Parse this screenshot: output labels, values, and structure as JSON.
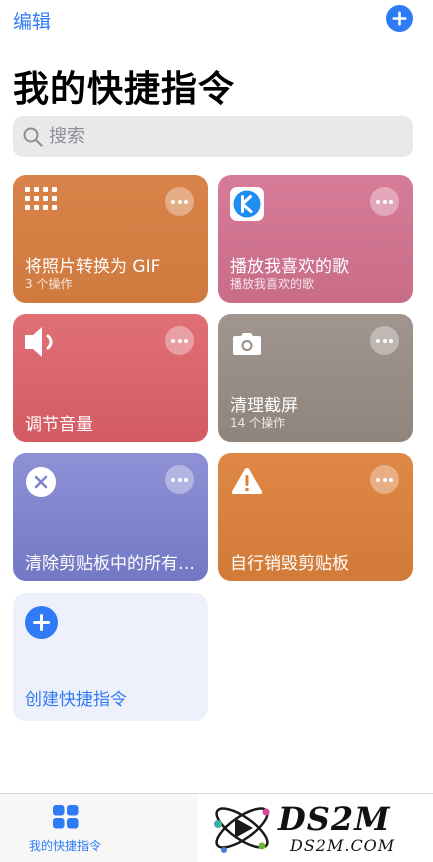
{
  "nav": {
    "edit_label": "编辑",
    "add_icon": "plus-circle-icon"
  },
  "page_title": "我的快捷指令",
  "search": {
    "placeholder": "搜索",
    "value": ""
  },
  "cards": [
    {
      "title": "将照片转换为 GIF",
      "subtitle": "3 个操作",
      "icon": "grid-icon",
      "color": "#d47e44"
    },
    {
      "title": "播放我喜欢的歌",
      "subtitle": "播放我喜欢的歌",
      "icon": "kugou-app-icon",
      "color": "#cf7390"
    },
    {
      "title": "调节音量",
      "subtitle": "",
      "icon": "speaker-icon",
      "color": "#da6369"
    },
    {
      "title": "清理截屏",
      "subtitle": "14 个操作",
      "icon": "camera-icon",
      "color": "#978d86"
    },
    {
      "title": "清除剪贴板中的所有内容",
      "subtitle": "",
      "icon": "x-circle-icon",
      "color": "#7f83cc"
    },
    {
      "title": "自行销毁剪贴板",
      "subtitle": "",
      "icon": "warning-icon",
      "color": "#d8803e"
    }
  ],
  "create_card": {
    "title": "创建快捷指令",
    "icon": "plus-circle-icon"
  },
  "tabbar": {
    "tab_label": "我的快捷指令",
    "tab_icon": "grid-tab-icon"
  },
  "watermark": {
    "title": "DS2M",
    "url": "DS2M.COM"
  },
  "colors": {
    "accent": "#2f7bf6"
  }
}
